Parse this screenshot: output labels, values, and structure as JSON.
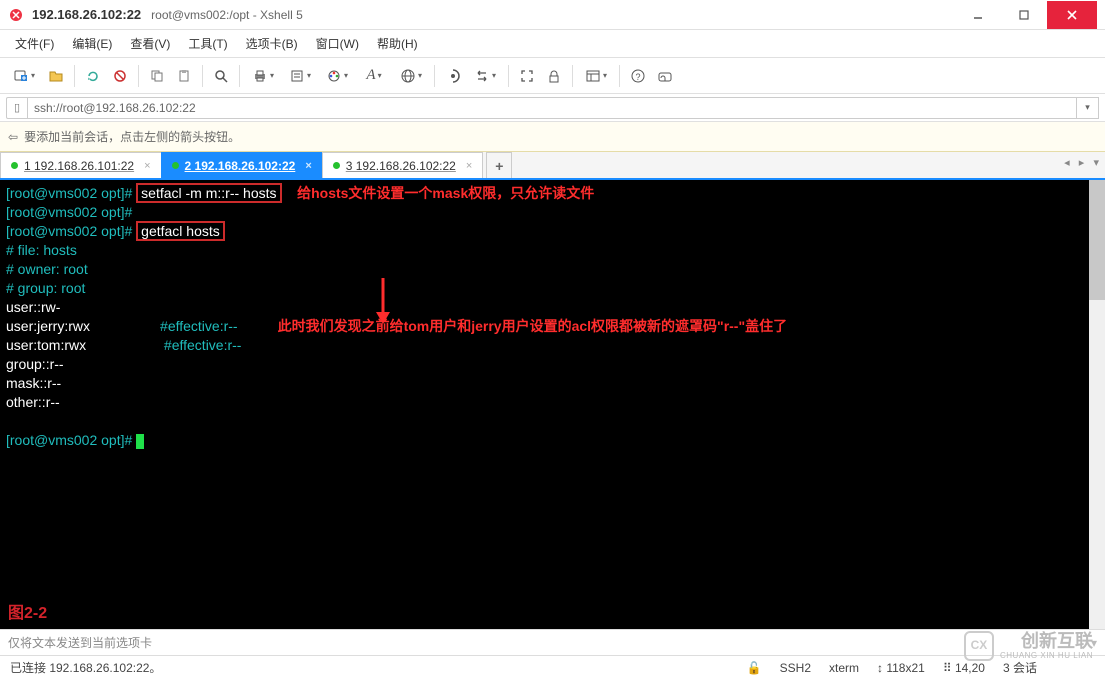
{
  "window": {
    "address": "192.168.26.102:22",
    "subtitle": "root@vms002:/opt - Xshell 5"
  },
  "menu": {
    "file": "文件(F)",
    "edit": "编辑(E)",
    "view": "查看(V)",
    "tools": "工具(T)",
    "tab": "选项卡(B)",
    "window": "窗口(W)",
    "help": "帮助(H)"
  },
  "address_bar": {
    "url": "ssh://root@192.168.26.102:22"
  },
  "hint": {
    "text": "要添加当前会话，点击左侧的箭头按钮。"
  },
  "tabs": [
    {
      "label": "1 192.168.26.101:22",
      "active": false
    },
    {
      "label": "2 192.168.26.102:22",
      "active": true
    },
    {
      "label": "3 192.168.26.102:22",
      "active": false
    }
  ],
  "terminal": {
    "prompt1": "[root@vms002 opt]# ",
    "cmd1": "setfacl -m m::r-- hosts",
    "ann1": "给hosts文件设置一个mask权限，只允许读文件",
    "prompt2": "[root@vms002 opt]# ",
    "prompt3": "[root@vms002 opt]# ",
    "cmd2": "getfacl hosts",
    "out_file": "# file: hosts",
    "out_owner": "# owner: root",
    "out_group": "# group: root",
    "out_user": "user::rw-",
    "out_jerry": "user:jerry:rwx",
    "out_jerry_eff": "#effective:r--",
    "out_tom": "user:tom:rwx",
    "out_tom_eff": "#effective:r--",
    "out_grp": "group::r--",
    "out_mask": "mask::r--",
    "out_other": "other::r--",
    "prompt4": "[root@vms002 opt]# ",
    "ann2": "此时我们发现之前给tom用户和jerry用户设置的acl权限都被新的遮罩码\"r--\"盖住了",
    "figure_label": "图2-2"
  },
  "send_bar": {
    "text": "仅将文本发送到当前选项卡"
  },
  "status": {
    "connected": "已连接 192.168.26.102:22。",
    "proto": "SSH2",
    "term": "xterm",
    "size": "118x21",
    "cursor": "14,20",
    "sessions": "3 会话"
  },
  "watermark": {
    "big": "创新互联",
    "small": "CHUANG XIN HU LIAN"
  }
}
